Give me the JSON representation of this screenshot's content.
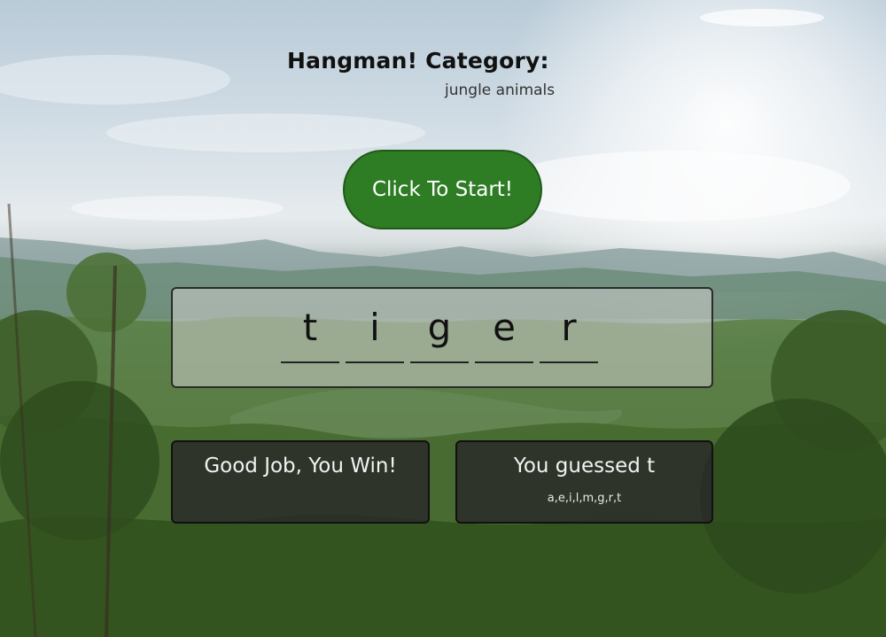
{
  "header": {
    "title": "Hangman! Category:",
    "category": "jungle animals"
  },
  "controls": {
    "start_label": "Click To Start!",
    "start_color": "#2e7d24"
  },
  "word": {
    "letters": [
      "t",
      "i",
      "g",
      "e",
      "r"
    ]
  },
  "status": {
    "result_message": "Good Job, You Win!",
    "last_guess_message": "You guessed t",
    "guessed_letters": "a,e,i,l,m,g,r,t"
  }
}
